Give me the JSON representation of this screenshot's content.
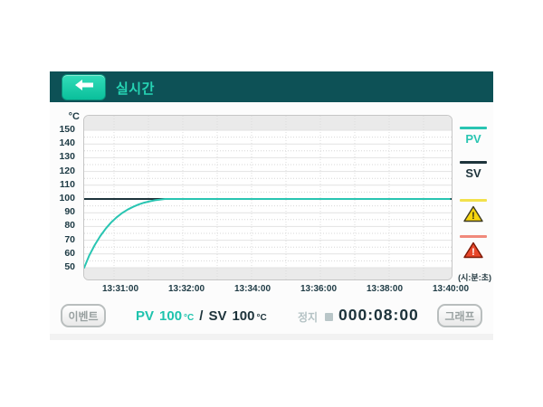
{
  "header": {
    "title": "실시간",
    "bg_color": "#0d5156",
    "title_color": "#26d4b4",
    "back_icon": "left-arrow-icon"
  },
  "colors": {
    "pv": "#29c5b2",
    "sv": "#1d333b",
    "accent_button": "#12cfa6",
    "alarm_yellow_line": "#f2e14c",
    "alarm_yellow_fill": "#f6d50e",
    "alarm_red_line": "#f0897b",
    "alarm_red_fill": "#e8472b",
    "muted": "#b5c3c5",
    "axis_text": "#1d3a44"
  },
  "legend": [
    {
      "label": "PV",
      "type": "line",
      "color": "#29c5b2"
    },
    {
      "label": "SV",
      "type": "line",
      "color": "#1d333b"
    },
    {
      "label": "",
      "type": "warning-triangle-yellow",
      "color": "#f6d50e"
    },
    {
      "label": "",
      "type": "warning-triangle-red",
      "color": "#e8472b"
    }
  ],
  "axis_note": "(시:분:초)",
  "chart_data": {
    "type": "line",
    "ylabel": "°C",
    "ylim": [
      50,
      150
    ],
    "yticks": [
      150,
      140,
      130,
      120,
      110,
      100,
      90,
      80,
      70,
      60,
      50
    ],
    "xticks": [
      "13:31:00",
      "13:32:00",
      "13:34:00",
      "13:36:00",
      "13:38:00",
      "13:40:00"
    ],
    "x_unit_note": "(시:분:초)",
    "grid": true,
    "legend_position": "right",
    "x_axis": {
      "tick_fractions": [
        0.1005,
        0.2794,
        0.4583,
        0.6373,
        0.8162,
        0.9951
      ]
    },
    "series": [
      {
        "name": "SV",
        "color": "#1d333b",
        "setpoint": 100
      },
      {
        "name": "PV",
        "color": "#29c5b2",
        "points": [
          {
            "t": "13:30:26",
            "v": 50
          },
          {
            "t": "13:30:31",
            "v": 59
          },
          {
            "t": "13:30:36",
            "v": 66.5
          },
          {
            "t": "13:30:41",
            "v": 73
          },
          {
            "t": "13:30:46",
            "v": 78.5
          },
          {
            "t": "13:30:51",
            "v": 83
          },
          {
            "t": "13:30:56",
            "v": 86.7
          },
          {
            "t": "13:31:01",
            "v": 89.8
          },
          {
            "t": "13:31:06",
            "v": 92.3
          },
          {
            "t": "13:31:11",
            "v": 94.3
          },
          {
            "t": "13:31:16",
            "v": 96
          },
          {
            "t": "13:31:21",
            "v": 97.3
          },
          {
            "t": "13:31:26",
            "v": 98.3
          },
          {
            "t": "13:31:31",
            "v": 99.1
          },
          {
            "t": "13:31:36",
            "v": 99.6
          },
          {
            "t": "13:31:40",
            "v": 100
          },
          {
            "t": "13:40:00",
            "v": 100
          }
        ]
      }
    ]
  },
  "footer": {
    "event_button": "이벤트",
    "graph_button": "그래프",
    "pv_label": "PV",
    "pv_value": "100",
    "pv_unit": "°C",
    "separator": "/",
    "sv_label": "SV",
    "sv_value": "100",
    "sv_unit": "°C",
    "status_label": "정지",
    "timer": "000:08:00"
  }
}
